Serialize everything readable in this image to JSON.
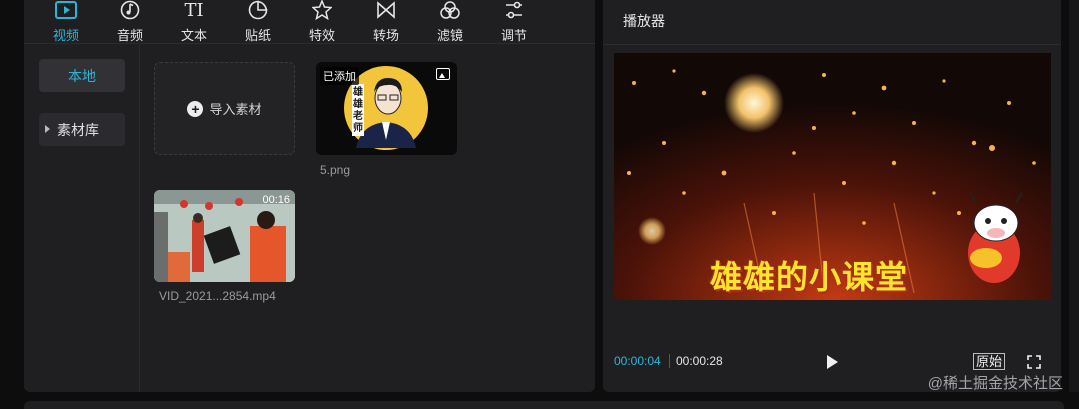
{
  "toolbar": {
    "tabs": [
      {
        "label": "视频",
        "icon": "video-icon",
        "active": true
      },
      {
        "label": "音频",
        "icon": "music-note-icon"
      },
      {
        "label": "文本",
        "icon": "text-icon"
      },
      {
        "label": "贴纸",
        "icon": "sticker-icon"
      },
      {
        "label": "特效",
        "icon": "effects-star-icon"
      },
      {
        "label": "转场",
        "icon": "transition-icon"
      },
      {
        "label": "滤镜",
        "icon": "filter-icon"
      },
      {
        "label": "调节",
        "icon": "adjust-sliders-icon"
      }
    ]
  },
  "sidebar": {
    "local_label": "本地",
    "library_label": "素材库"
  },
  "media": {
    "import_label": "导入素材",
    "items": [
      {
        "name": "5.png",
        "badge": "已添加",
        "type_icon": "image-icon",
        "portrait_text": "雄雄老师"
      },
      {
        "name": "VID_2021...2854.mp4",
        "duration": "00:16"
      }
    ]
  },
  "player": {
    "title": "播放器",
    "caption": "雄雄的小课堂",
    "current_time": "00:00:04",
    "total_time": "00:00:28",
    "ratio_label": "原始",
    "fullscreen_icon": "fullscreen-icon"
  },
  "watermark": "@稀土掘金技术社区",
  "colors": {
    "accent": "#2bb6d9",
    "panel": "#1f1f22",
    "caption": "#ffe62b"
  }
}
